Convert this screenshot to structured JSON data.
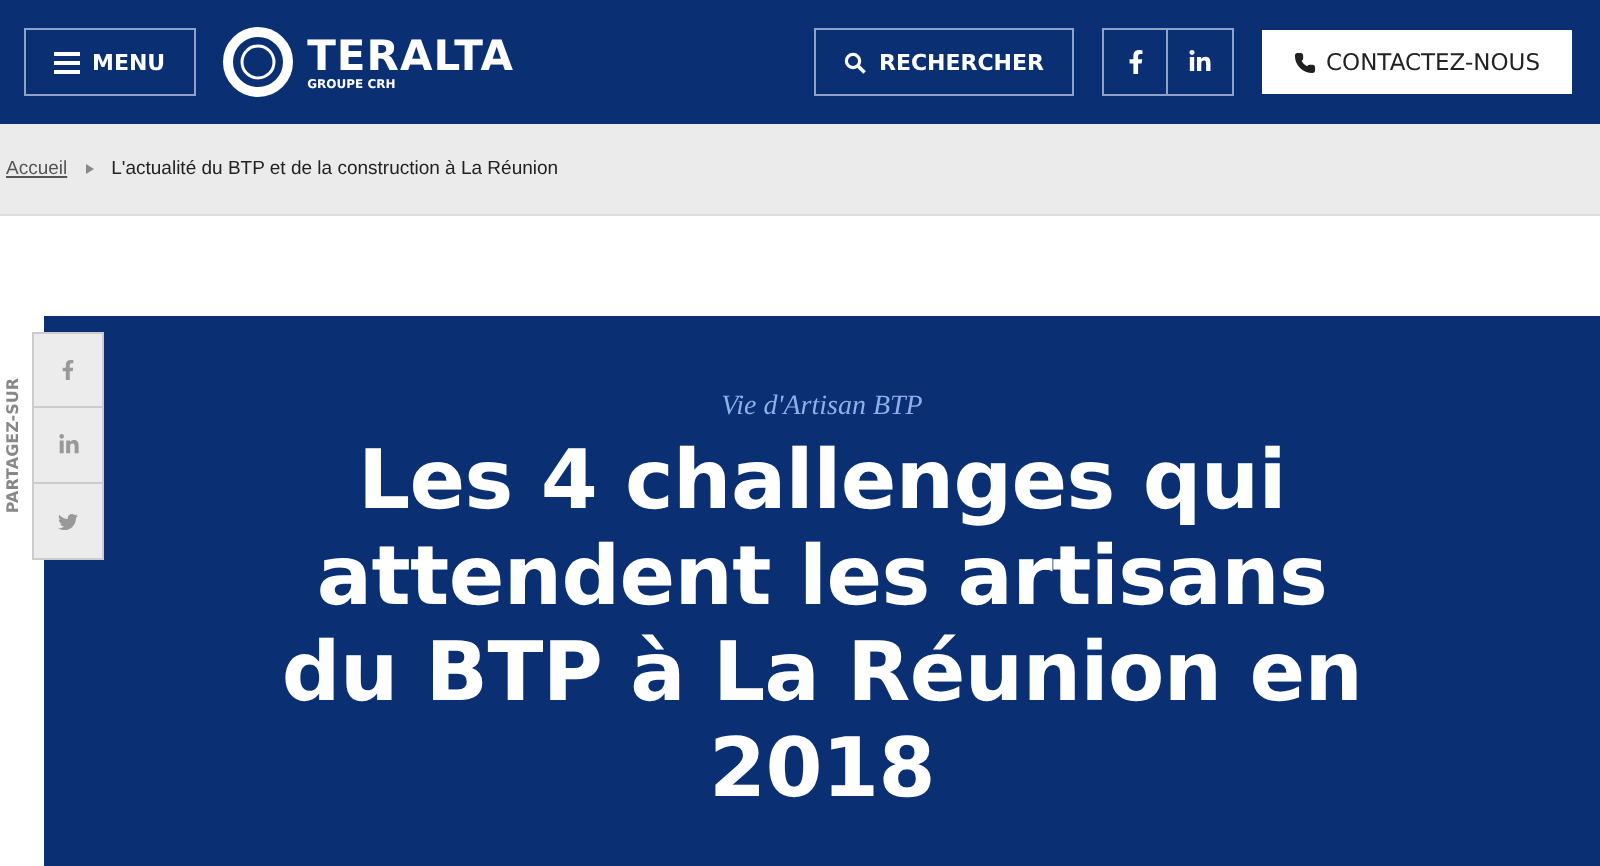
{
  "header": {
    "menu_button": "MENU",
    "logo": {
      "name": "TERALTA",
      "subtitle": "GROUPE CRH"
    },
    "search_button": "RECHERCHER",
    "contact_button": "CONTACTEZ-NOUS"
  },
  "breadcrumb": [
    "Accueil",
    "L'actualité du BTP et de la construction à La Réunion"
  ],
  "share": {
    "label": "PARTAGEZ-SUR"
  },
  "article": {
    "category": "Vie d'Artisan BTP",
    "title": "Les 4 challenges qui attendent les artisans du BTP à La Réunion en 2018"
  }
}
